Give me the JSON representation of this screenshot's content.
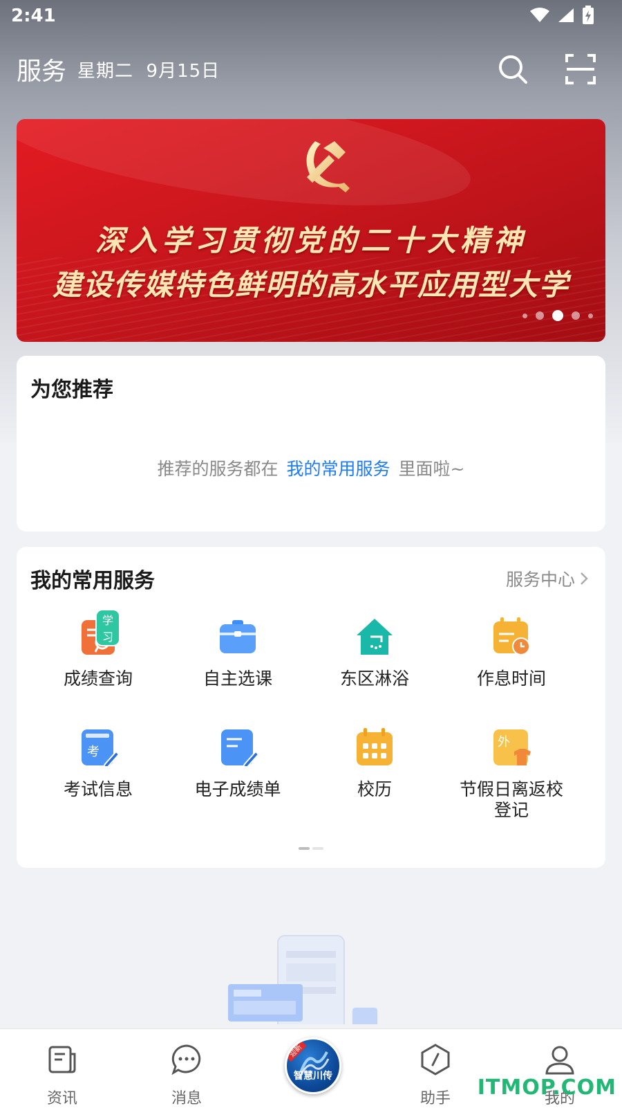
{
  "status_bar": {
    "time": "2:41",
    "icons": [
      "wifi-icon",
      "signal-icon",
      "battery-charging-icon"
    ]
  },
  "header": {
    "title": "服务",
    "date": "星期二  9月15日",
    "icons": [
      "search-icon",
      "scan-icon"
    ]
  },
  "banner": {
    "line1": "深入学习贯彻党的二十大精神",
    "line2": "建设传媒特色鲜明的高水平应用型大学",
    "active_slide": 3,
    "slide_count": 5,
    "colors": {
      "primary": "#d8161e",
      "text": "#fde6b4"
    }
  },
  "recommend": {
    "title": "为您推荐",
    "text_before": "推荐的服务都在",
    "link": "我的常用服务",
    "text_after": "里面啦~"
  },
  "services": {
    "title": "我的常用服务",
    "center_link": "服务中心",
    "badge": "学习",
    "items": [
      {
        "label": "成绩查询",
        "icon": "grade-query-icon",
        "color": "#f0703a"
      },
      {
        "label": "自主选课",
        "icon": "briefcase-icon",
        "color": "#3e8ef7"
      },
      {
        "label": "东区淋浴",
        "icon": "shower-house-icon",
        "color": "#19b8a8"
      },
      {
        "label": "作息时间",
        "icon": "schedule-clock-icon",
        "color": "#f5b235"
      },
      {
        "label": "考试信息",
        "icon": "exam-edit-icon",
        "color": "#3e8ef7"
      },
      {
        "label": "电子成绩单",
        "icon": "transcript-edit-icon",
        "color": "#3e8ef7"
      },
      {
        "label": "校历",
        "icon": "calendar-icon",
        "color": "#f5b235"
      },
      {
        "label": "节假日离返校\n登记",
        "label_line1": "节假日离返校",
        "label_line2": "登记",
        "icon": "leave-school-icon",
        "icon_text": "外",
        "color": "#f5b235"
      }
    ],
    "page_count": 2,
    "active_page": 1
  },
  "bottom_nav": {
    "items": [
      {
        "label": "资讯",
        "icon": "news-icon"
      },
      {
        "label": "消息",
        "icon": "message-icon"
      },
      {
        "label": "助手",
        "icon": "assistant-icon"
      },
      {
        "label": "我的",
        "icon": "profile-icon"
      }
    ],
    "center": {
      "text": "智慧川传",
      "ribbon": "迎新",
      "icon": "app-logo-icon"
    }
  },
  "watermark": "ITMOP.COM"
}
